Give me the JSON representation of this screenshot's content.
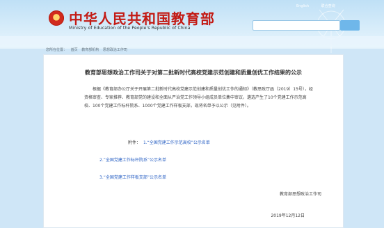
{
  "header": {
    "title": "中华人民共和国教育部",
    "subtitle": "Ministry of Education of the People's Republic of China",
    "links": [
      "English",
      "联合查询"
    ],
    "search_button": ""
  },
  "breadcrumb": [
    "您所在位置：",
    "首页",
    "教育部机构",
    "思想政治工作司"
  ],
  "article": {
    "title": "教育部思想政治工作司关于对第二批新时代高校党建示范创建和质量创优工作结果的公示",
    "paragraph": "根据《教育部办公厅关于开展第二批新时代高校党建示范创建和质量创优工作的通知》（教思政厅函〔2019〕15号），经资格审查、专家推荐、教育部党的建设和全面从严治党工作领导小组成员单位集中审议，遴选产生了10个党建工作示范高校、100个党建工作标杆院系、1000个党建工作样板支部，现将名单予以公示（见附件）。",
    "attachments_label": "附件：",
    "attachments": [
      "1.“全国党建工作示范高校”公示名单",
      "2.“全国党建工作标杆院系”公示名单",
      "3.“全国党建工作样板支部”公示名单"
    ],
    "signature": "教育部思想政治工作司",
    "date": "2019年12月12日"
  }
}
